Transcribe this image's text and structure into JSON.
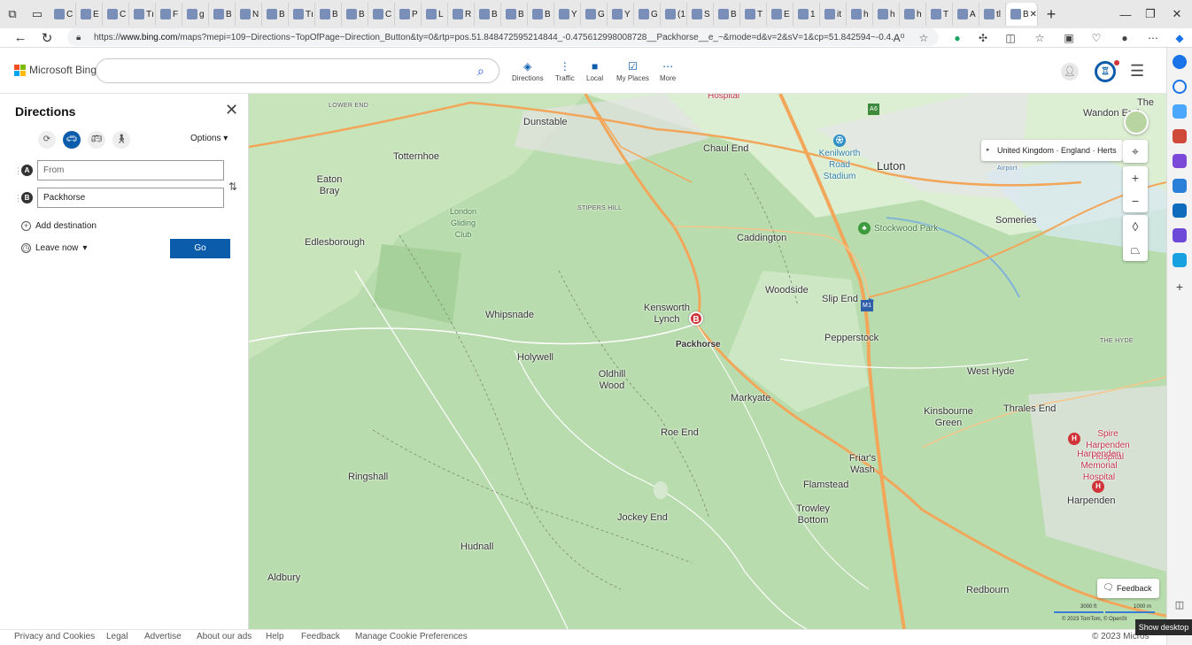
{
  "browser": {
    "url_prefix": "https://",
    "url_host": "www.bing.com",
    "url_rest": "/maps?mepi=109~Directions~TopOfPage~Direction_Button&ty=0&rtp=pos.51.848472595214844_-0.475612998008728__Packhorse__e_~&mode=d&v=2&sV=1&cp=51.842594~-0.4...",
    "tabs": [
      "C",
      "E",
      "C",
      "Tı",
      "F",
      "g",
      "B",
      "N",
      "B",
      "Tı",
      "B",
      "B",
      "C",
      "P",
      "L",
      "R",
      "B",
      "B",
      "B",
      "Y",
      "G",
      "Y",
      "G",
      "(1",
      "S",
      "B",
      "T",
      "E",
      "1",
      "it",
      "h",
      "h",
      "h",
      "T",
      "A",
      "tl",
      "B"
    ],
    "reader_label": "A⁰"
  },
  "header": {
    "brand": "Microsoft Bing",
    "search_value": "",
    "nav": [
      {
        "label": "Directions",
        "icon": "directions-icon"
      },
      {
        "label": "Traffic",
        "icon": "traffic-icon"
      },
      {
        "label": "Local",
        "icon": "local-icon"
      },
      {
        "label": "My Places",
        "icon": "my-places-icon"
      },
      {
        "label": "More",
        "icon": "more-icon"
      }
    ]
  },
  "panel": {
    "title": "Directions",
    "options_label": "Options",
    "from_placeholder": "From",
    "to_value": "Packhorse",
    "letter_a": "A",
    "letter_b": "B",
    "add_destination": "Add destination",
    "leave_now": "Leave now",
    "go": "Go"
  },
  "map": {
    "breadcrumb": "United Kingdom · England · Herts",
    "pin_label": "B",
    "pin_place": "Packhorse",
    "places": [
      "Hospital",
      "Dunstable",
      "LOWER END",
      "Totternhoe",
      "Eaton Bray",
      "Chaul End",
      "Kenilworth Road Stadium",
      "Luton",
      "STIPERS HILL",
      "London Gliding Club",
      "Edlesborough",
      "Caddington",
      "Stockwood Park",
      "Someries",
      "Woodside",
      "Slip End",
      "Kensworth Lynch",
      "Whipsnade",
      "Pepperstock",
      "THE HYDE",
      "Holywell",
      "Oldhill Wood",
      "Markyate",
      "West Hyde",
      "Kinsbourne Green",
      "Thrales End",
      "Roe End",
      "Spire Harpenden Hospital",
      "Harpenden Memorial Hospital",
      "Friar's Wash",
      "Ringshall",
      "Flamstead",
      "Trowley Bottom",
      "Harpenden",
      "Jockey End",
      "Hudnall",
      "Aldbury",
      "Redbourn",
      "Wandon End",
      "The",
      "A6",
      "M1",
      "Airport"
    ],
    "feedback": "Feedback",
    "scale_ft": "3000 ft",
    "scale_m": "1000 m",
    "copyright": "© 2023 TomTom, © OpenSt"
  },
  "footer": {
    "links": [
      "Privacy and Cookies",
      "Legal",
      "Advertise",
      "About our ads",
      "Help",
      "Feedback",
      "Manage Cookie Preferences"
    ],
    "copyright": "© 2023 Micros"
  },
  "taskbar": {
    "show_desktop": "Show desktop"
  },
  "colors": {
    "accent": "#0b5cab",
    "pin": "#d13438",
    "map_green": "#b9dcae",
    "road": "#f2a65a"
  }
}
